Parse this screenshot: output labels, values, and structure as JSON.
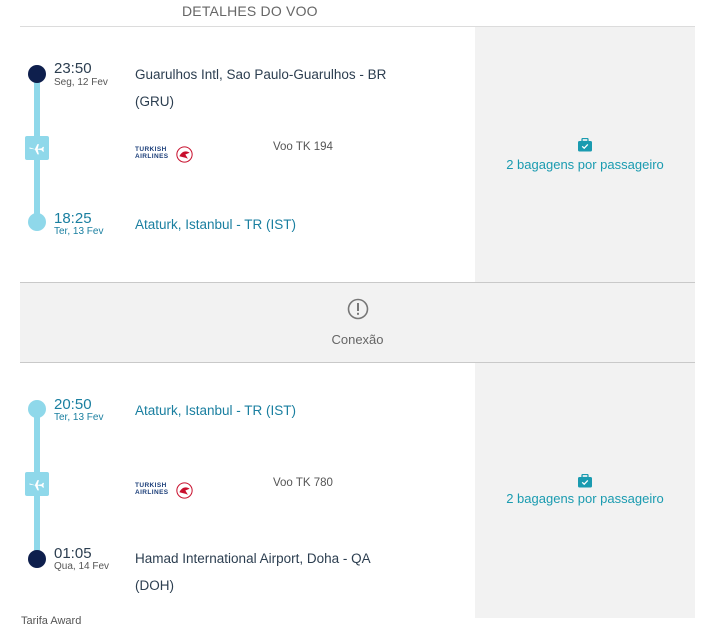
{
  "header": {
    "title": "DETALHES DO VOO"
  },
  "segments": [
    {
      "departure": {
        "time": "23:50",
        "date": "Seg, 12 Fev",
        "airport_line1": "Guarulhos Intl, Sao Paulo-Guarulhos - BR",
        "airport_line2": "(GRU)"
      },
      "airline": {
        "name_line1": "TURKISH",
        "name_line2": "AIRLINES"
      },
      "flight": "Voo TK 194",
      "arrival": {
        "time": "18:25",
        "date": "Ter, 13 Fev",
        "airport_line1": "Ataturk, Istanbul - TR (IST)",
        "airport_line2": ""
      },
      "baggage": "2 bagagens por passageiro"
    },
    {
      "departure": {
        "time": "20:50",
        "date": "Ter, 13 Fev",
        "airport_line1": "Ataturk, Istanbul - TR (IST)",
        "airport_line2": ""
      },
      "airline": {
        "name_line1": "TURKISH",
        "name_line2": "AIRLINES"
      },
      "flight": "Voo TK 780",
      "arrival": {
        "time": "01:05",
        "date": "Qua, 14 Fev",
        "airport_line1": "Hamad International Airport, Doha - QA",
        "airport_line2": "(DOH)"
      },
      "baggage": "2 bagagens por passageiro"
    }
  ],
  "connection": {
    "label": "Conexão",
    "icon": "alert-circle-icon"
  },
  "footer": {
    "fare": "Tarifa Award"
  },
  "icons": {
    "plane": "plane-icon",
    "baggage": "suitcase-check-icon",
    "airline": "turkish-airlines-logo"
  },
  "colors": {
    "accent": "#1a9bb0",
    "timeline": "#8fd8ea",
    "dark_dot": "#0e1f4d",
    "panel": "#f2f2f2",
    "brand_red": "#c8102e"
  }
}
